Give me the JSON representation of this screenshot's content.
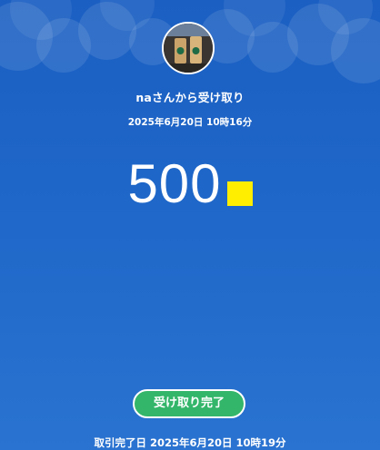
{
  "transfer": {
    "sender_text": "naさんから受け取り",
    "sent_datetime": "2025年6月20日 10時16分",
    "amount": "500",
    "status_button": "受け取り完了",
    "completed_label": "取引完了日 2025年6月20日 10時19分"
  },
  "colors": {
    "background": "#1e66c8",
    "currency_mark": "#ffee00",
    "status_button": "#33b56a"
  },
  "icons": {
    "currency": "yellow-square-icon",
    "avatar": "user-avatar-photo"
  }
}
